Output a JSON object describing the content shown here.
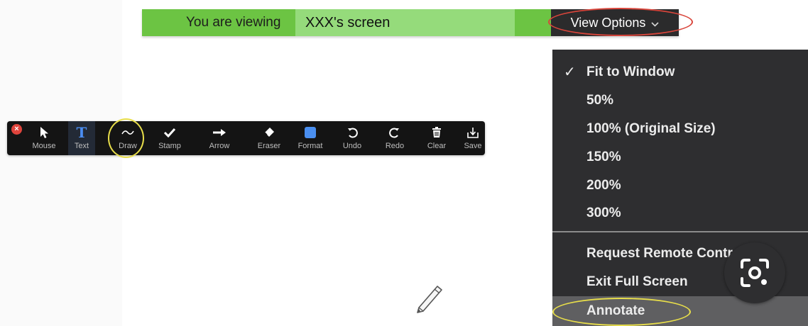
{
  "banner": {
    "prefix": "You are viewing",
    "sharer": "XXX's screen",
    "view_options_label": "View Options",
    "view_options_icon": "chevron-down-icon"
  },
  "menu": {
    "items": [
      {
        "label": "Fit to Window",
        "checked": true
      },
      {
        "label": "50%",
        "checked": false
      },
      {
        "label": "100% (Original Size)",
        "checked": false
      },
      {
        "label": "150%",
        "checked": false
      },
      {
        "label": "200%",
        "checked": false
      },
      {
        "label": "300%",
        "checked": false
      },
      {
        "label": "Request Remote Control",
        "checked": false
      },
      {
        "label": "Exit Full Screen",
        "checked": false
      },
      {
        "label": "Annotate",
        "checked": false,
        "highlighted": true
      }
    ],
    "check_glyph": "✓"
  },
  "toolbar": {
    "close_glyph": "×",
    "tools": [
      {
        "label": "Mouse",
        "icon": "cursor-arrow-icon"
      },
      {
        "label": "Text",
        "icon": "text-t-icon",
        "active": true
      },
      {
        "label": "Draw",
        "icon": "squiggle-icon"
      },
      {
        "label": "Stamp",
        "icon": "checkmark-icon"
      },
      {
        "label": "Arrow",
        "icon": "arrow-right-icon"
      },
      {
        "label": "Eraser",
        "icon": "eraser-icon"
      },
      {
        "label": "Format",
        "icon": "format-swatch-icon"
      },
      {
        "label": "Undo",
        "icon": "undo-icon"
      },
      {
        "label": "Redo",
        "icon": "redo-icon"
      },
      {
        "label": "Clear",
        "icon": "trash-icon"
      },
      {
        "label": "Save",
        "icon": "save-tray-icon"
      }
    ]
  },
  "colors": {
    "banner_green": "#6cc443",
    "sharer_green": "#95db7b",
    "menu_bg": "#2e2e30",
    "highlight_ring_red": "#d9453b",
    "highlight_ring_yellow": "#e8de4a",
    "format_blue": "#4a8ff0"
  }
}
